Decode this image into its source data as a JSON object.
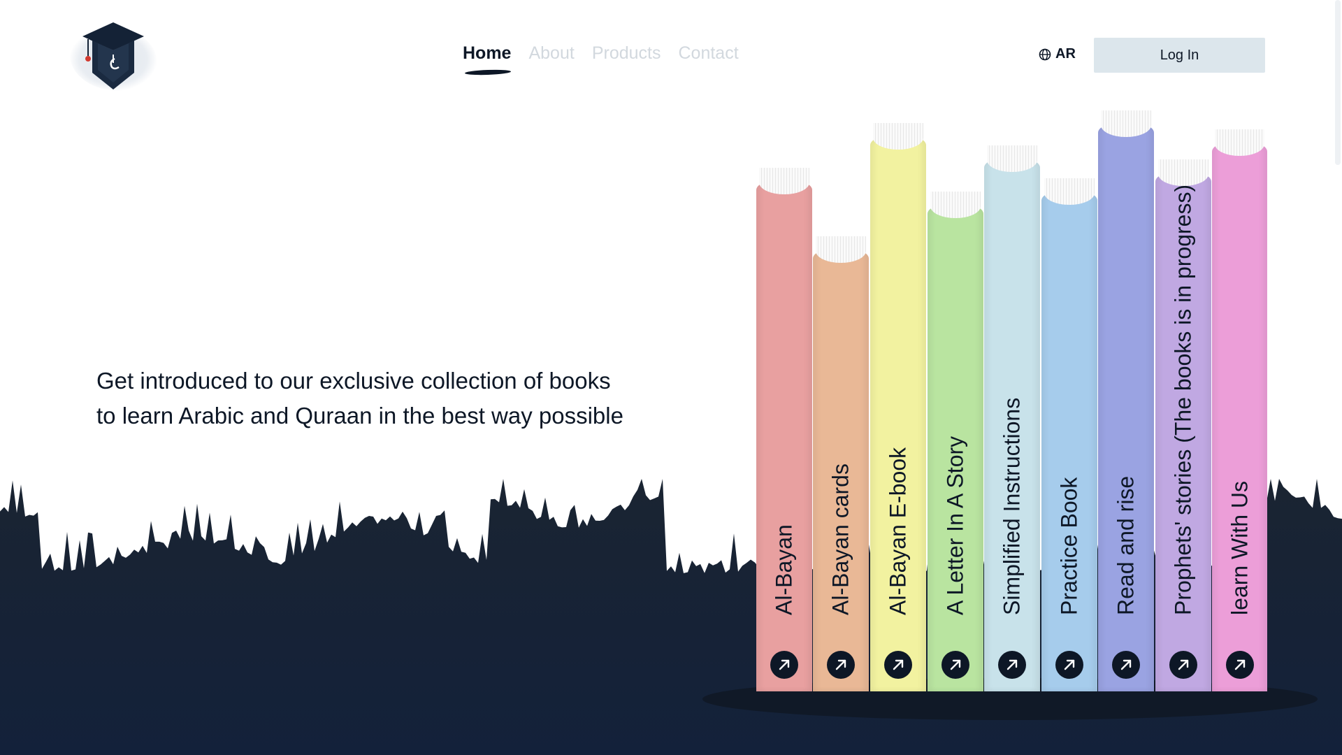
{
  "nav": {
    "items": [
      {
        "label": "Home",
        "active": true
      },
      {
        "label": "About",
        "active": false
      },
      {
        "label": "Products",
        "active": false
      },
      {
        "label": "Contact",
        "active": false
      }
    ]
  },
  "header": {
    "language_label": "AR",
    "language_icon": "globe-icon",
    "login_label": "Log In"
  },
  "hero": {
    "intro_line1": "Get introduced to our exclusive collection of books",
    "intro_line2": "to learn Arabic and Quraan in the best way possible"
  },
  "books": [
    {
      "title": "Al-Bayan",
      "color": "#e8a0a0"
    },
    {
      "title": "Al-Bayan cards",
      "color": "#e9b896"
    },
    {
      "title": "Al-Bayan E-book",
      "color": "#f2f2a0"
    },
    {
      "title": "A Letter In A Story",
      "color": "#b9e4a0"
    },
    {
      "title": "Simplified Instructions",
      "color": "#c8e2ea"
    },
    {
      "title": "Practice Book",
      "color": "#a6ccec"
    },
    {
      "title": "Read and rise",
      "color": "#9aa3e2"
    },
    {
      "title": "Prophets' stories (The books is in progress).",
      "color": "#c0a8e2"
    },
    {
      "title": "learn With Us",
      "color": "#ec9ed8"
    }
  ],
  "colors": {
    "dark": "#0d1726",
    "login_bg": "#dce6ec",
    "nav_inactive": "#d2d8de"
  }
}
